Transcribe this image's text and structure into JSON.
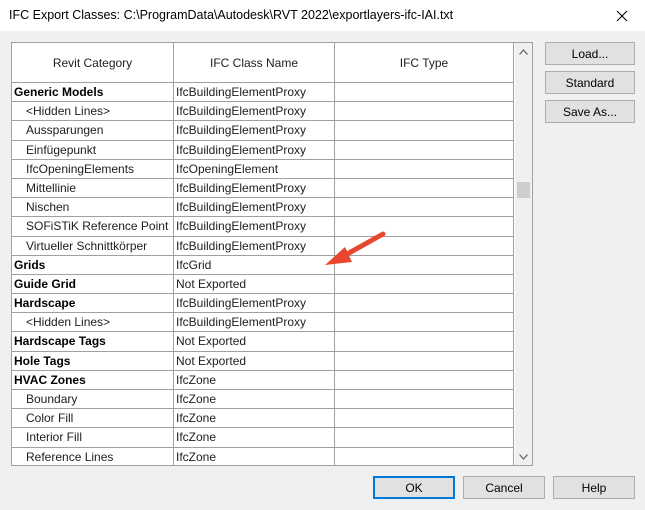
{
  "window": {
    "title": "IFC Export Classes: C:\\ProgramData\\Autodesk\\RVT 2022\\exportlayers-ifc-IAI.txt"
  },
  "table": {
    "headers": [
      "Revit Category",
      "IFC Class Name",
      "IFC Type"
    ],
    "rows": [
      {
        "category": "Generic Models",
        "ifc_class": "IfcBuildingElementProxy",
        "ifc_type": "",
        "bold": true
      },
      {
        "category": "<Hidden Lines>",
        "ifc_class": "IfcBuildingElementProxy",
        "ifc_type": "",
        "bold": false
      },
      {
        "category": "Aussparungen",
        "ifc_class": "IfcBuildingElementProxy",
        "ifc_type": "",
        "bold": false
      },
      {
        "category": "Einfügepunkt",
        "ifc_class": "IfcBuildingElementProxy",
        "ifc_type": "",
        "bold": false
      },
      {
        "category": "IfcOpeningElements",
        "ifc_class": "IfcOpeningElement",
        "ifc_type": "",
        "bold": false
      },
      {
        "category": "Mittellinie",
        "ifc_class": "IfcBuildingElementProxy",
        "ifc_type": "",
        "bold": false
      },
      {
        "category": "Nischen",
        "ifc_class": "IfcBuildingElementProxy",
        "ifc_type": "",
        "bold": false
      },
      {
        "category": "SOFiSTiK Reference Point",
        "ifc_class": "IfcBuildingElementProxy",
        "ifc_type": "",
        "bold": false
      },
      {
        "category": "Virtueller Schnittkörper",
        "ifc_class": "IfcBuildingElementProxy",
        "ifc_type": "",
        "bold": false
      },
      {
        "category": "Grids",
        "ifc_class": "IfcGrid",
        "ifc_type": "",
        "bold": true
      },
      {
        "category": "Guide Grid",
        "ifc_class": "Not Exported",
        "ifc_type": "",
        "bold": true
      },
      {
        "category": "Hardscape",
        "ifc_class": "IfcBuildingElementProxy",
        "ifc_type": "",
        "bold": true
      },
      {
        "category": "<Hidden Lines>",
        "ifc_class": "IfcBuildingElementProxy",
        "ifc_type": "",
        "bold": false
      },
      {
        "category": "Hardscape Tags",
        "ifc_class": "Not Exported",
        "ifc_type": "",
        "bold": true
      },
      {
        "category": "Hole Tags",
        "ifc_class": "Not Exported",
        "ifc_type": "",
        "bold": true
      },
      {
        "category": "HVAC Zones",
        "ifc_class": "IfcZone",
        "ifc_type": "",
        "bold": true
      },
      {
        "category": "Boundary",
        "ifc_class": "IfcZone",
        "ifc_type": "",
        "bold": false
      },
      {
        "category": "Color Fill",
        "ifc_class": "IfcZone",
        "ifc_type": "",
        "bold": false
      },
      {
        "category": "Interior Fill",
        "ifc_class": "IfcZone",
        "ifc_type": "",
        "bold": false
      },
      {
        "category": "Reference Lines",
        "ifc_class": "IfcZone",
        "ifc_type": "",
        "bold": false
      }
    ]
  },
  "buttons": {
    "load": "Load...",
    "standard": "Standard",
    "save_as": "Save As...",
    "ok": "OK",
    "cancel": "Cancel",
    "help": "Help"
  },
  "colors": {
    "annotation_arrow": "#e8472f",
    "default_button_border": "#0078d7"
  },
  "icons": {
    "close": "close-icon",
    "scroll_up": "chevron-up-icon",
    "scroll_down": "chevron-down-icon",
    "annotation": "arrow-icon"
  }
}
